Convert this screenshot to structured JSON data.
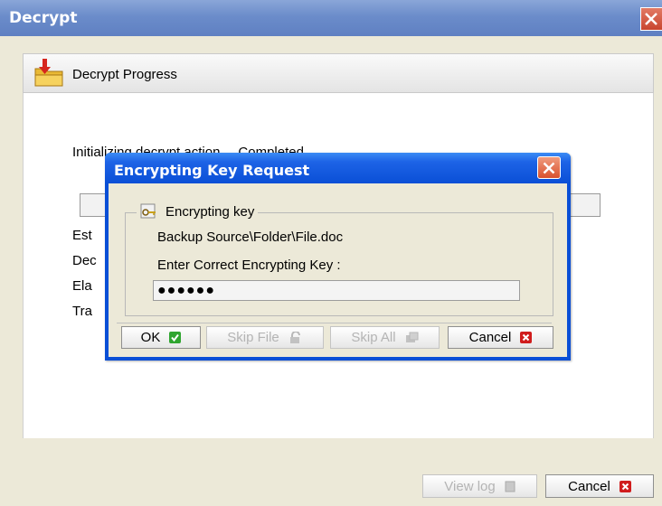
{
  "window": {
    "title": "Decrypt",
    "header_title": "Decrypt Progress",
    "status_text": "Initializing decrypt action",
    "status_value": "Completed",
    "info_labels": [
      "Est",
      "Dec",
      "Ela",
      "Tra"
    ],
    "buttons": {
      "view_log": "View log",
      "cancel": "Cancel"
    }
  },
  "dialog": {
    "title": "Encrypting Key Request",
    "group_label": "Encrypting key",
    "file_path": "Backup Source\\Folder\\File.doc",
    "prompt": "Enter Correct Encrypting Key :",
    "password_mask": "●●●●●●",
    "buttons": {
      "ok": "OK",
      "skip_file": "Skip File",
      "skip_all": "Skip All",
      "cancel": "Cancel"
    }
  },
  "icons": {
    "window_close": "close-icon",
    "header": "folder-download-icon",
    "dialog_close": "close-icon",
    "group": "key-icon",
    "ok": "check-icon",
    "skip_file": "unlock-icon",
    "skip_all": "skip-all-icon",
    "cancel": "x-icon",
    "view_log": "document-icon"
  },
  "colors": {
    "title_bar": "#6b8cca",
    "dialog_title_bar": "#0a4fd6",
    "close_red": "#d8512f",
    "ok_green": "#2fa52f",
    "cancel_red": "#d01c1c"
  }
}
